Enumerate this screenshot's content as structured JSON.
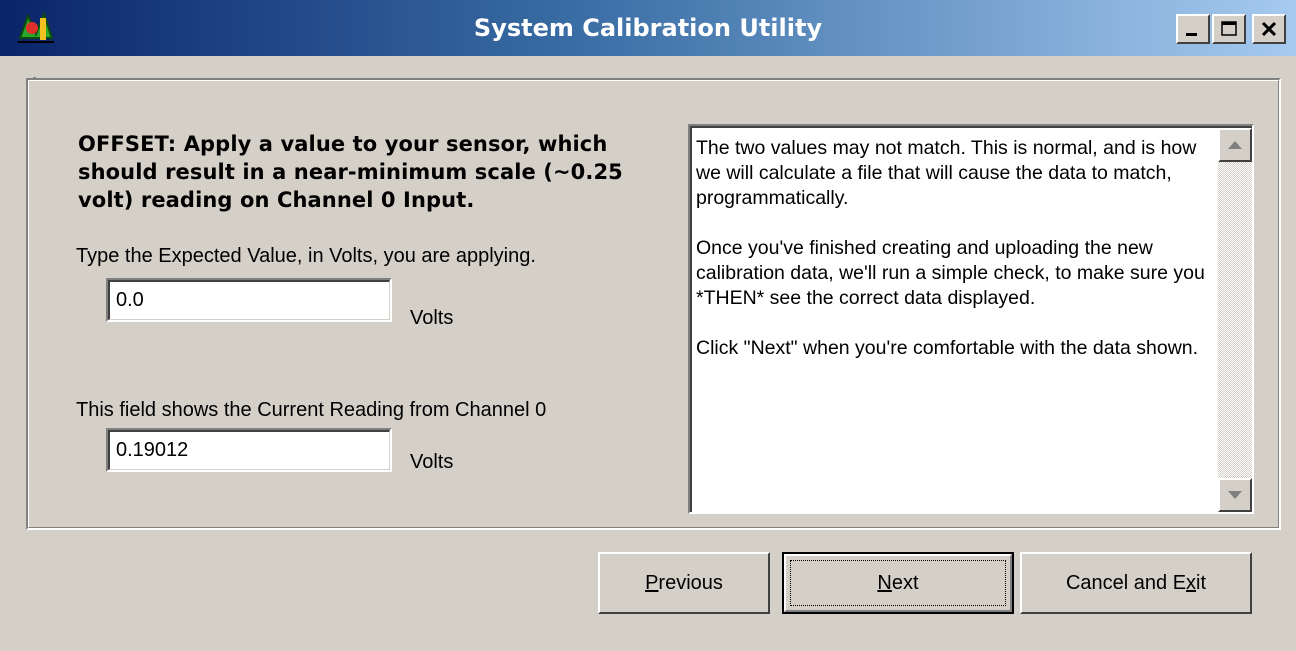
{
  "window": {
    "title": "System Calibration Utility",
    "controls": {
      "minimize_icon": "minimize-icon",
      "maximize_icon": "maximize-icon",
      "close_icon": "close-icon"
    }
  },
  "main": {
    "heading": "OFFSET: Apply a value to your sensor, which should result in a near-minimum scale (~0.25 volt) reading on Channel 0 Input.",
    "expected": {
      "label": "Type the Expected Value, in Volts, you are applying.",
      "value": "0.0",
      "unit": "Volts"
    },
    "current": {
      "label": "This field shows the Current Reading from Channel 0",
      "value": "0.19012",
      "unit": "Volts"
    },
    "info_text": {
      "p1": "The two values may not match.  This is normal, and is how we will calculate a file that will cause the data to match, programmatically.",
      "p2": "Once you've finished creating and uploading the new calibration data, we'll run a simple check, to make sure you *THEN* see the correct data displayed.",
      "p3": "Click \"Next\" when you're comfortable with the data shown."
    }
  },
  "buttons": {
    "previous": {
      "pre": "",
      "accel": "P",
      "post": "revious"
    },
    "next": {
      "pre": "",
      "accel": "N",
      "post": "ext"
    },
    "cancel": {
      "pre": "Cancel and E",
      "accel": "x",
      "post": "it"
    }
  },
  "colors": {
    "titlebar_start": "#0a246a",
    "titlebar_end": "#a6caf0",
    "face": "#d4d0c8"
  }
}
